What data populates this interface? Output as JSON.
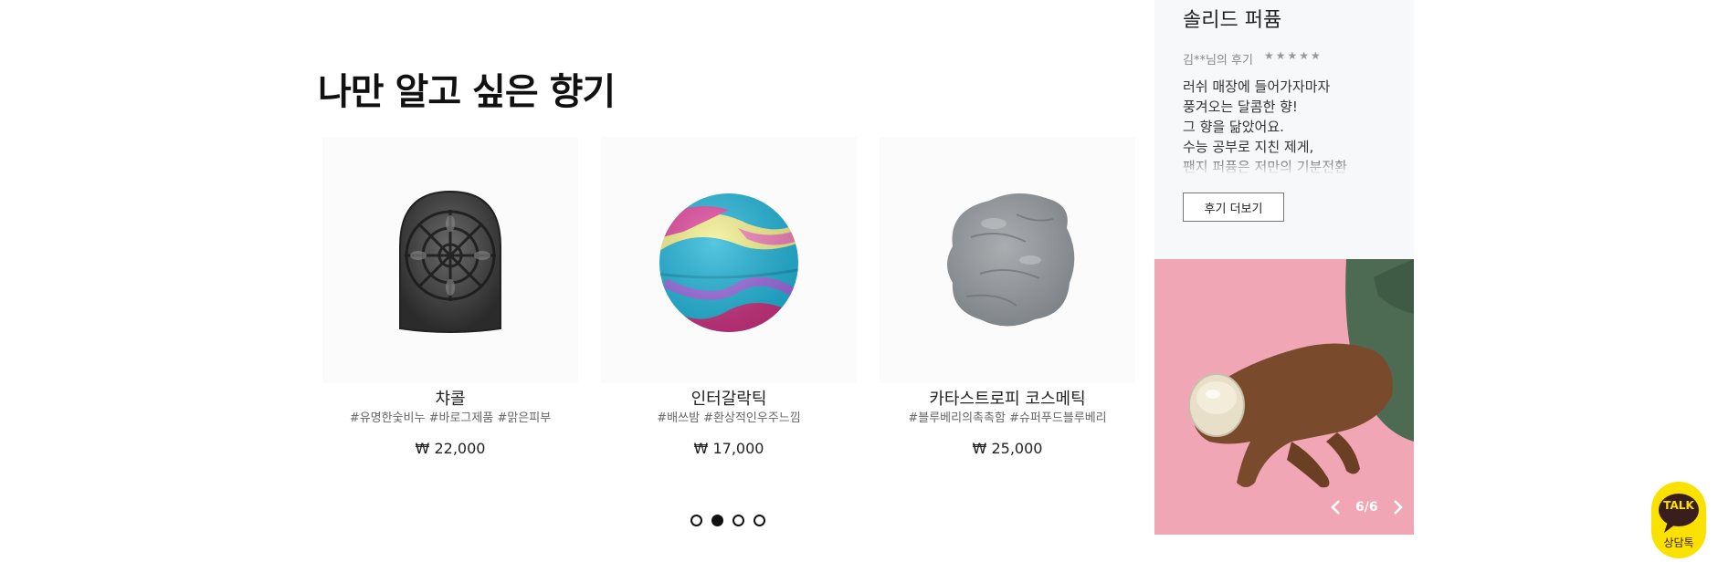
{
  "section": {
    "title": "나만 알고 싶은 향기"
  },
  "products": [
    {
      "name": "챠콜",
      "tags": "#유명한숯비누 #바로그제품 #맑은피부",
      "price": "₩ 22,000",
      "image_icon": "charcoal-soap-image"
    },
    {
      "name": "인터갈락틱",
      "tags": "#배쓰밤 #환상적인우주느낌",
      "price": "₩ 17,000",
      "image_icon": "bath-bomb-image"
    },
    {
      "name": "카타스트로피 코스메틱",
      "tags": "#블루베리의촉촉함 #슈퍼푸드블루베리",
      "price": "₩ 25,000",
      "image_icon": "face-mask-image"
    }
  ],
  "carousel": {
    "page_count": 4,
    "active_index": 1
  },
  "review": {
    "product_name": "솔리드 퍼퓸",
    "author": "김**님의 후기",
    "rating": 5,
    "stars": "★★★★★",
    "body_lines": [
      "러쉬 매장에 들어가자마자",
      "풍겨오는 달콤한 향!",
      "그 향을 닮았어요.",
      "수능 공부로 지친 제게,",
      "팬지 퍼퓸은 저만의 기분전환"
    ],
    "more_button": "후기 더보기",
    "slide_counter": "6/6",
    "photo_colors": {
      "background": "#f1a6b6",
      "sleeve": "#4d6b52",
      "skin": "#7a4a2c"
    }
  },
  "chat": {
    "bubble_label": "TALK",
    "label": "상담톡",
    "color": "#fae100"
  }
}
